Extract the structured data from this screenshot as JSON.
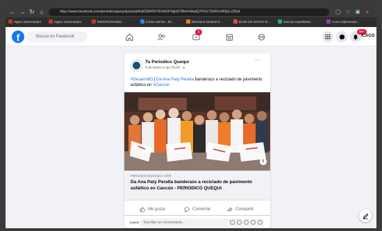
{
  "browser": {
    "url": "https://www.facebook.com/periodicoquequi/posts/pfbid02kM3hY8XdN3t7fgkW7Bk4nWqdQ7Fh2cT9xRXmB5pLvZ8sd",
    "bookmarks": [
      {
        "label": "Sigmo Sancionador",
        "color": "#c0392b"
      },
      {
        "label": "Sigmo Sancionador",
        "color": "#c0392b"
      },
      {
        "label": "INE/CP/CR/ADN/…",
        "color": "#c0392b"
      },
      {
        "label": "Iniciar mail de - 2b…",
        "color": "#2e86de"
      },
      {
        "label": "Directorio General d…",
        "color": "#e67e22"
      },
      {
        "label": "BASE DE DATOS SI…",
        "color": "#e74c3c"
      },
      {
        "label": "sancion expediente…",
        "color": "#27ae60"
      },
      {
        "label": "Curso Optimizado…",
        "color": "#8e44ad"
      }
    ]
  },
  "facebook": {
    "search_placeholder": "Buscar en Facebook",
    "watch_badge": "1",
    "notif_badge": "99+",
    "profile_name": "ICACO"
  },
  "post": {
    "page_name": "Tu Periodico Quequi",
    "timestamp": "4 de enero a las 16:03 · ",
    "text_hashtag1": "#DesarrollO",
    "text_sep": " | ",
    "text_mention": "Da Ana Paty Peralta",
    "text_body": " banderazo a reciclado de pavimento asfáltico en ",
    "text_hashtag2": "#Cancún",
    "link_domain": "PERIODICOQUEQUI.COM",
    "link_title": "Da Ana Paty Peralta banderazo a reciclado de pavimento asfáltico en Cancún - PERIODICO QUEQUI",
    "like_label": "Me gusta",
    "comment_label": "Comentar",
    "share_label": "Compartir",
    "comment_placeholder": "Escribe un comentario...",
    "commenter_label": "ICACO"
  }
}
